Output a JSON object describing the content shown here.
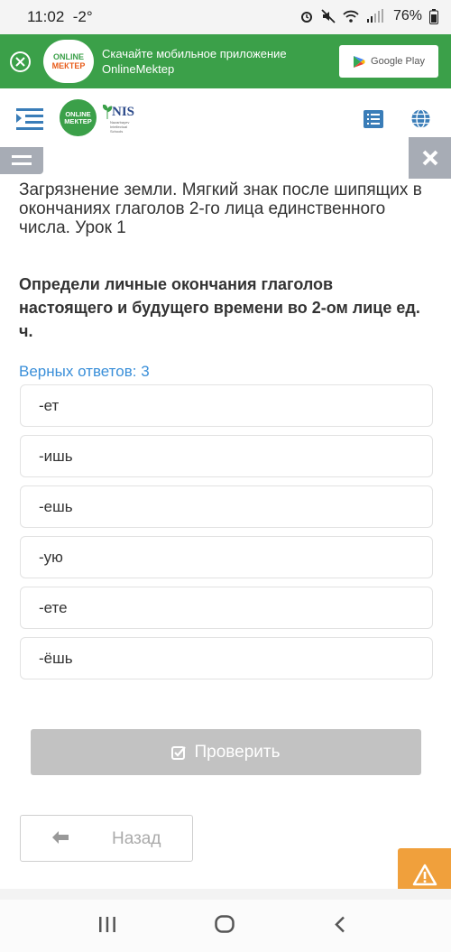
{
  "status_bar": {
    "time": "11:02",
    "extra": "-2°",
    "battery": "76%"
  },
  "banner": {
    "logo_line1": "ONLINE",
    "logo_line2": "МЕКТЕР",
    "text_line1": "Скачайте мобильное приложение",
    "text_line2": "OnlineMektep",
    "store_label": "Google Play"
  },
  "header": {
    "logo_line1": "ONLINE",
    "logo_line2": "МЕКТЕР",
    "nis_label": "NIS",
    "nis_sub1": "Nazarbayev",
    "nis_sub2": "Intellectual",
    "nis_sub3": "Schools"
  },
  "lesson": {
    "title": "Загрязнение земли. Мягкий знак после шипящих в окончаниях глаголов 2-го лица единственного числа. Урок 1",
    "question": "Определи личные окончания глаголов настоящего и будущего времени во 2-ом лице ед. ч.",
    "correct_count": "Верных ответов: 3"
  },
  "answers": [
    "-ет",
    "-ишь",
    "-ешь",
    "-ую",
    "-ете",
    "-ёшь"
  ],
  "buttons": {
    "check": "Проверить",
    "back": "Назад"
  },
  "colors": {
    "brand_green": "#3ba049",
    "accent_blue": "#3a8fd9",
    "warning_orange": "#f0a03c",
    "disabled_gray": "#c2c2c2"
  }
}
